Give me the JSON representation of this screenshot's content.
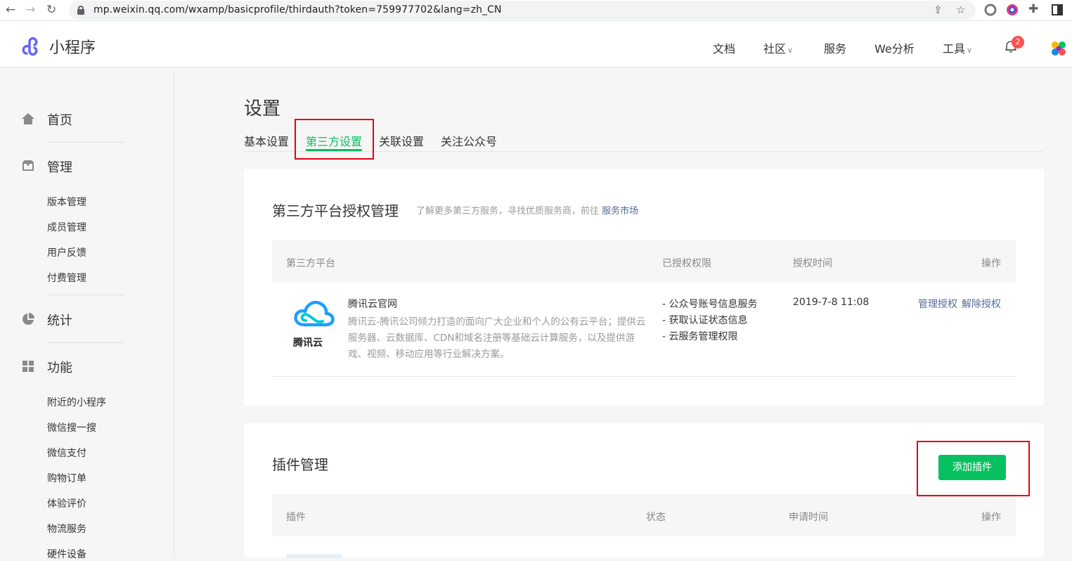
{
  "browser": {
    "url": "mp.weixin.qq.com/wxamp/basicprofile/thirdauth?token=759977702&lang=zh_CN"
  },
  "header": {
    "logo_text": "小程序",
    "nav": [
      "文档",
      "社区",
      "服务",
      "We分析",
      "工具"
    ],
    "notification_count": "2",
    "accent_color": "#07c160"
  },
  "sidebar": {
    "groups": [
      {
        "label": "首页",
        "icon": "home-icon",
        "items": []
      },
      {
        "label": "管理",
        "icon": "inbox-icon",
        "items": [
          "版本管理",
          "成员管理",
          "用户反馈",
          "付费管理"
        ]
      },
      {
        "label": "统计",
        "icon": "pie-chart-icon",
        "items": []
      },
      {
        "label": "功能",
        "icon": "grid-icon",
        "items": [
          "附近的小程序",
          "微信搜一搜",
          "微信支付",
          "购物订单",
          "体验评价",
          "物流服务",
          "硬件设备"
        ]
      }
    ]
  },
  "main": {
    "title": "设置",
    "tabs": [
      "基本设置",
      "第三方设置",
      "关联设置",
      "关注公众号"
    ],
    "active_tab": "第三方设置",
    "auth_card": {
      "title": "第三方平台授权管理",
      "desc": "了解更多第三方服务，寻找优质服务商，前往",
      "desc_link": "服务市场",
      "columns": [
        "第三方平台",
        "已授权权限",
        "授权时间",
        "操作"
      ],
      "rows": [
        {
          "logo_text": "腾讯云",
          "name": "腾讯云官网",
          "desc": "腾讯云-腾讯公司倾力打造的面向广大企业和个人的公有云平台；提供云服务器、云数据库、CDN和域名注册等基础云计算服务，以及提供游戏、视频、移动应用等行业解决方案。",
          "permissions": [
            "- 公众号账号信息服务",
            "- 获取认证状态信息",
            "- 云服务管理权限"
          ],
          "time": "2019-7-8 11:08",
          "actions": [
            "管理授权",
            "解除授权"
          ]
        }
      ]
    },
    "plugin_card": {
      "title": "插件管理",
      "add_button": "添加插件",
      "columns": [
        "插件",
        "状态",
        "申请时间",
        "操作"
      ]
    }
  }
}
